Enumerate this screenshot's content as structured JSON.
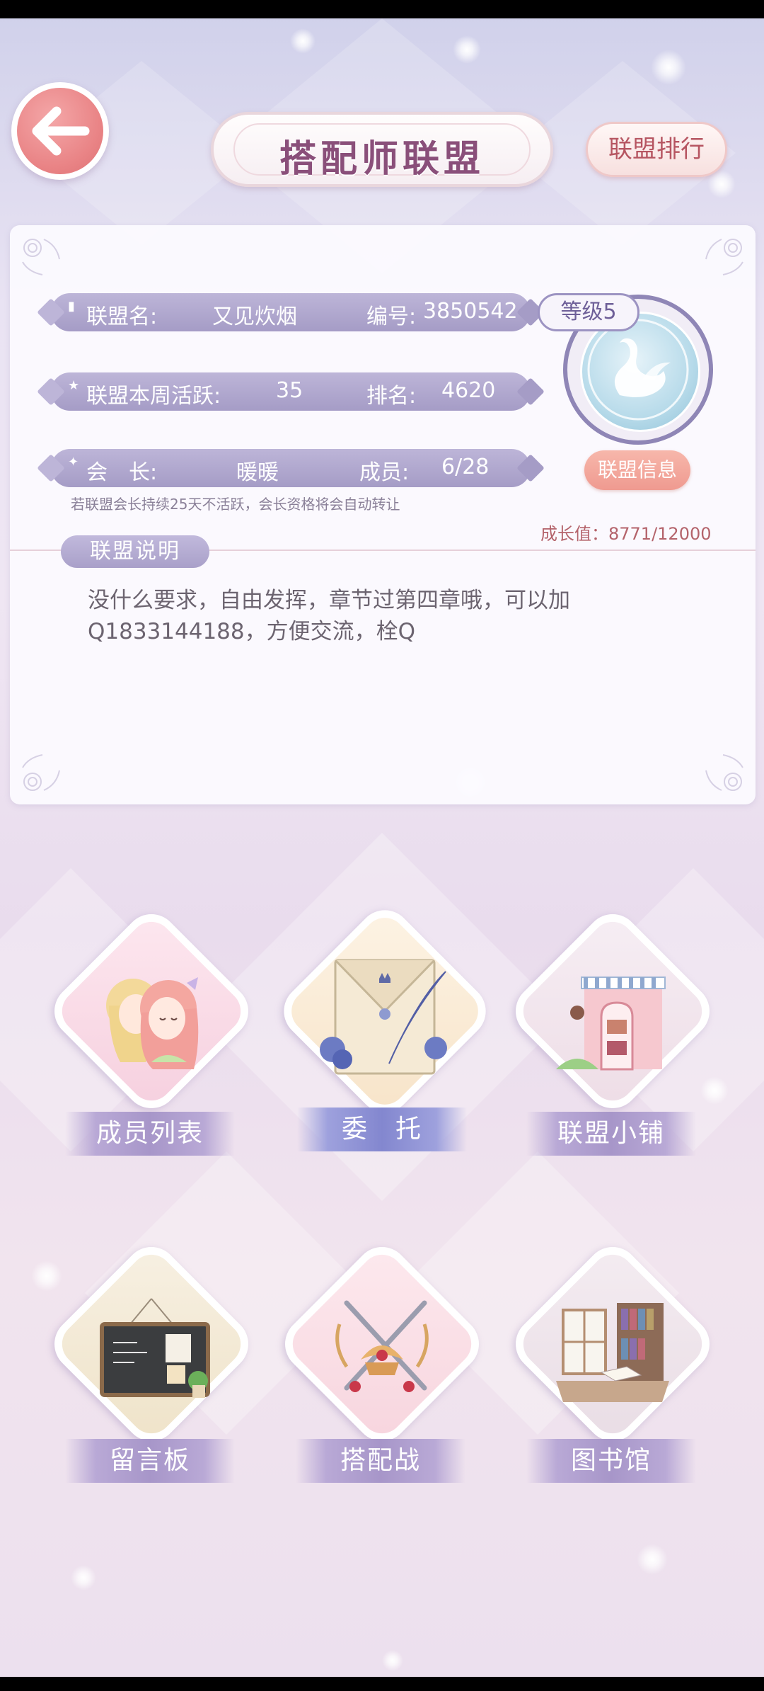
{
  "header": {
    "title": "搭配师联盟",
    "rank_button": "联盟排行"
  },
  "alliance": {
    "name_label": "联盟名:",
    "name_value": "又见炊烟",
    "id_label": "编号:",
    "id_value": "3850542",
    "activity_label": "联盟本周活跃:",
    "activity_value": "35",
    "rank_label": "排名:",
    "rank_value": "4620",
    "leader_label": "会　长:",
    "leader_value": "暖暖",
    "members_label": "成员:",
    "members_value": "6/28",
    "level": "等级5",
    "info_button": "联盟信息",
    "leader_note": "若联盟会长持续25天不活跃，会长资格将会自动转让",
    "growth": "成长值：8771/12000",
    "growth_value": 8771,
    "growth_max": 12000,
    "desc_label": "联盟说明",
    "description": "没什么要求，自由发挥，章节过第四章哦，可以加Q1833144188，方便交流，栓Q"
  },
  "features": [
    {
      "label": "成员列表"
    },
    {
      "label": "委　托"
    },
    {
      "label": "联盟小铺"
    },
    {
      "label": "留言板"
    },
    {
      "label": "搭配战"
    },
    {
      "label": "图书馆"
    }
  ],
  "icons": {
    "back": "arrow-left-icon",
    "emblem": "swan-emblem-icon"
  },
  "colors": {
    "accent": "#a59cc6",
    "back_button": "#e98385",
    "title_text": "#8a4f7a"
  }
}
